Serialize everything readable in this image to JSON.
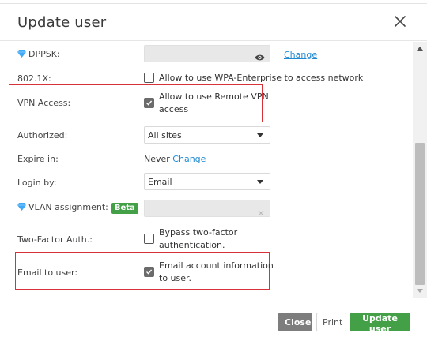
{
  "dialog": {
    "title": "Update user"
  },
  "fields": {
    "dppsk": {
      "label": "DPPSK:",
      "link": "Change"
    },
    "dot1x": {
      "label": "802.1X:",
      "checkbox_text": "Allow to use WPA-Enterprise to access network",
      "checked": false
    },
    "vpn": {
      "label": "VPN Access:",
      "checkbox_line1": "Allow to use Remote VPN",
      "checkbox_line2": "access",
      "checked": true
    },
    "authorized": {
      "label": "Authorized:",
      "value": "All sites"
    },
    "expire": {
      "label": "Expire in:",
      "value": "Never",
      "link": "Change"
    },
    "login_by": {
      "label": "Login by:",
      "value": "Email"
    },
    "vlan": {
      "label": "VLAN assignment:",
      "badge": "Beta"
    },
    "two_factor": {
      "label": "Two-Factor Auth.:",
      "checkbox_line1": "Bypass two-factor",
      "checkbox_line2": "authentication.",
      "checked": false
    },
    "email_user": {
      "label": "Email to user:",
      "checkbox_line1": "Email account information",
      "checkbox_line2": "to user.",
      "checked": true
    }
  },
  "footer": {
    "close_label": "Close",
    "print_label": "Print",
    "update_label": "Update user"
  },
  "colors": {
    "accent_green": "#43a047",
    "link_blue": "#1f8ad2",
    "highlight_red": "#d9313a",
    "diamond_blue": "#3fa9f5"
  },
  "icons": {
    "close": "close-icon",
    "eye": "eye-icon",
    "diamond": "diamond-icon",
    "clear": "clear-icon"
  }
}
